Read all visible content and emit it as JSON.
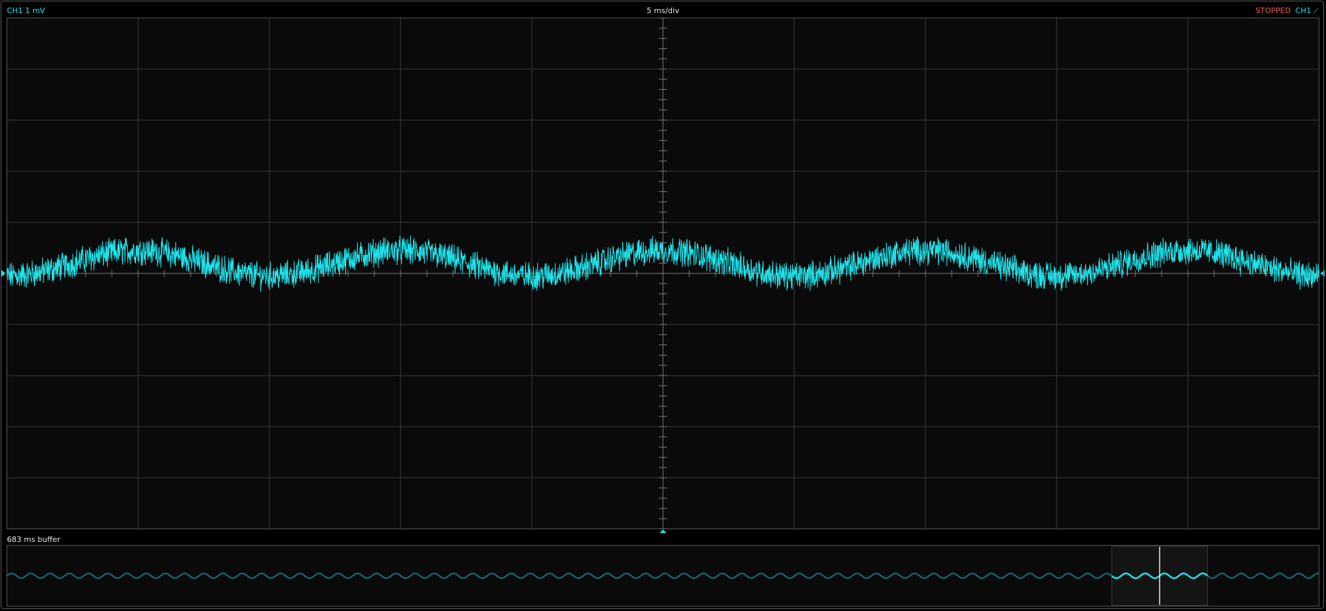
{
  "header": {
    "channel_scale": "CH1 1 mV",
    "timebase": "5 ms/div",
    "run_status": "STOPPED",
    "trigger_source": "CH1",
    "trigger_edge_icon": "rising-edge-icon"
  },
  "buffer": {
    "label": "683 ms buffer"
  },
  "colors": {
    "trace": "#1ee3ea",
    "trace_dim": "#1a6f78",
    "grid": "#3a3a3a",
    "background": "#0a0a0a",
    "status_stopped": "#e85a5a",
    "text": "#e6e6e6"
  },
  "chart_data": {
    "type": "line",
    "title": "",
    "xlabel": "",
    "ylabel": "",
    "divisions": {
      "x": 10,
      "y": 10
    },
    "volts_per_div_mV": 1,
    "time_per_div_ms": 5,
    "xlim_ms": [
      -25,
      25
    ],
    "ylim_mV": [
      -5,
      5
    ],
    "grid": true,
    "series": [
      {
        "channel": "CH1",
        "waveform": "sine",
        "amplitude_mV": 0.25,
        "offset_mV": 0.2,
        "period_ms": 10,
        "phase_ms": -2.5,
        "noise_pp_mV": 0.45
      }
    ],
    "buffer_duration_ms": 683,
    "viewport_position": [
      0.842,
      0.915
    ]
  }
}
